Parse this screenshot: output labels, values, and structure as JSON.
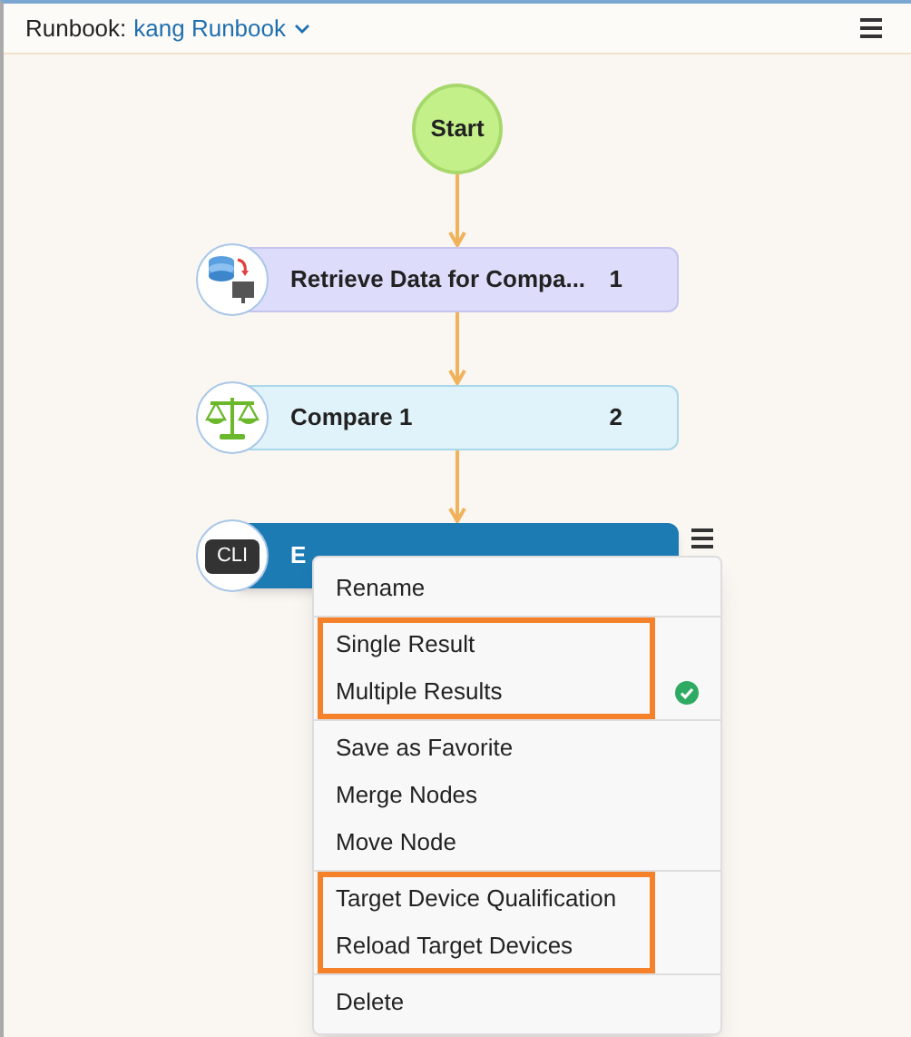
{
  "header": {
    "label": "Runbook:",
    "runbook_name": "kang Runbook"
  },
  "start_node": {
    "label": "Start"
  },
  "nodes": [
    {
      "kind": "data",
      "label": "Retrieve Data for Compa...",
      "number": "1",
      "selected": false
    },
    {
      "kind": "compare",
      "label": "Compare 1",
      "number": "2",
      "selected": false
    },
    {
      "kind": "cli",
      "label": "E",
      "icon_text": "CLI",
      "selected": true
    }
  ],
  "context_menu": {
    "sections": [
      {
        "highlighted": false,
        "items": [
          {
            "label": "Rename"
          }
        ]
      },
      {
        "highlighted": true,
        "items": [
          {
            "label": "Single Result",
            "checked": false
          },
          {
            "label": "Multiple Results",
            "checked": true
          }
        ]
      },
      {
        "highlighted": false,
        "items": [
          {
            "label": "Save as Favorite"
          },
          {
            "label": "Merge Nodes"
          },
          {
            "label": "Move Node"
          }
        ]
      },
      {
        "highlighted": true,
        "items": [
          {
            "label": "Target Device Qualification"
          },
          {
            "label": "Reload Target Devices"
          }
        ]
      },
      {
        "highlighted": false,
        "items": [
          {
            "label": "Delete"
          }
        ]
      }
    ]
  }
}
